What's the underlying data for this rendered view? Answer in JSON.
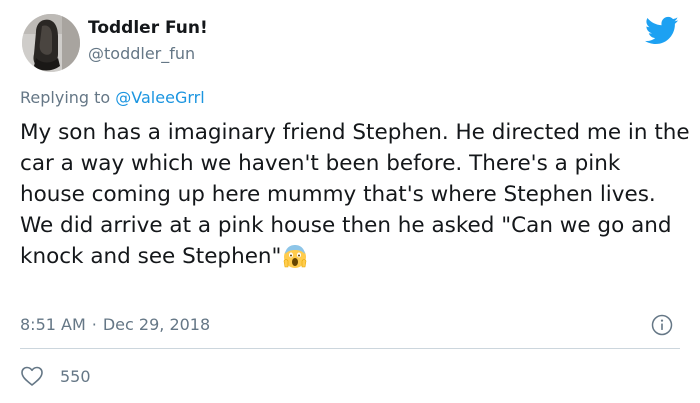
{
  "user": {
    "display_name": "Toddler Fun!",
    "handle": "@toddler_fun",
    "avatar_icon": "shoe-photo-avatar"
  },
  "logo_icon": "twitter-bird-icon",
  "reply": {
    "prefix": "Replying to ",
    "mention": "@ValeeGrrl"
  },
  "tweet": {
    "text": "My son has a imaginary friend Stephen. He directed me in the car a way which we haven't been before. There's a pink house coming up here mummy that's where Stephen lives.\nWe did arrive at a pink house then he asked \"Can we go and knock and see Stephen\"",
    "emoji_icon": "face-screaming-in-fear-emoji"
  },
  "meta": {
    "time": "8:51 AM",
    "separator": "·",
    "date": "Dec 29, 2018"
  },
  "actions": {
    "like_count": "550",
    "like_icon": "heart-icon",
    "info_icon": "info-icon"
  },
  "colors": {
    "accent": "#1da1f2",
    "link": "#1b95e0",
    "secondary_text": "#657786",
    "divider": "#ccd6dd"
  }
}
